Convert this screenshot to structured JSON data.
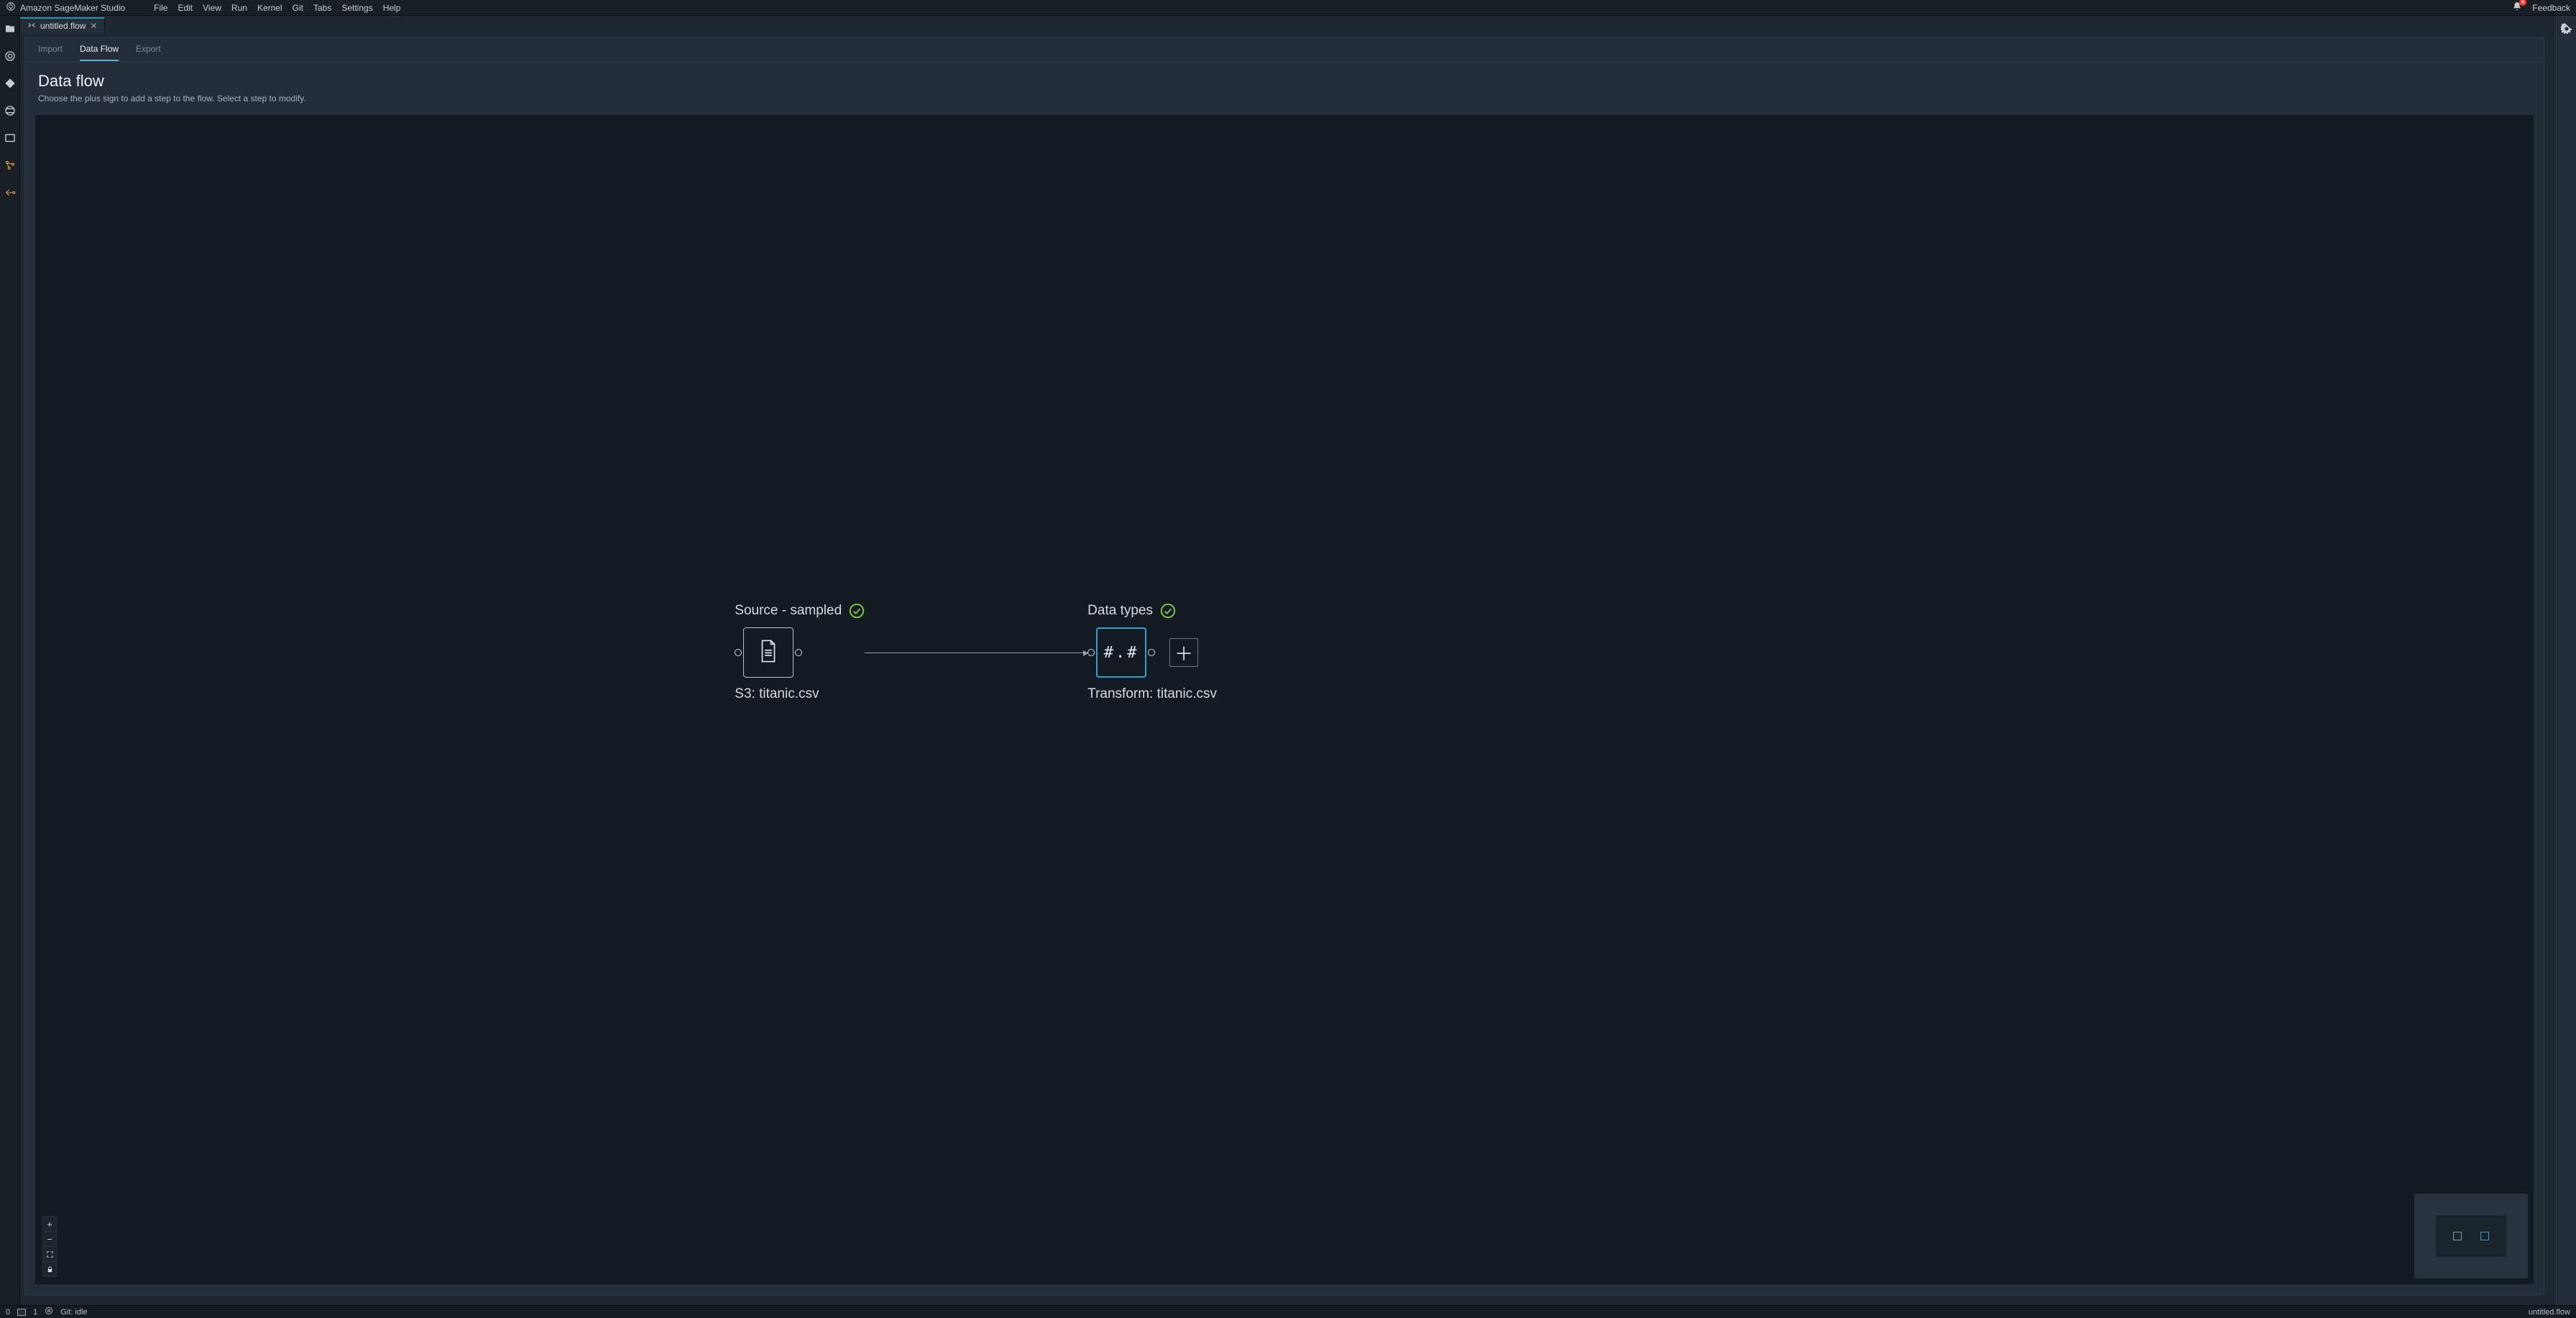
{
  "app": {
    "title": "Amazon SageMaker Studio"
  },
  "menu": {
    "file": "File",
    "edit": "Edit",
    "view": "View",
    "run": "Run",
    "kernel": "Kernel",
    "git": "Git",
    "tabs": "Tabs",
    "settings": "Settings",
    "help": "Help",
    "feedback": "Feedback",
    "notif_count": "4"
  },
  "tab": {
    "name": "untitled.flow"
  },
  "subtabs": {
    "import": "Import",
    "dataflow": "Data Flow",
    "export": "Export"
  },
  "header": {
    "title": "Data flow",
    "subtitle": "Choose the plus sign to add a step to the flow. Select a step to modify."
  },
  "nodes": {
    "source": {
      "title": "Source - sampled",
      "subtitle": "S3: titanic.csv"
    },
    "types": {
      "title": "Data types",
      "glyph": "#.#",
      "subtitle": "Transform: titanic.csv"
    }
  },
  "status": {
    "left_num": "0",
    "terminal_count": "1",
    "git": "Git: idle",
    "file": "untitled.flow"
  }
}
